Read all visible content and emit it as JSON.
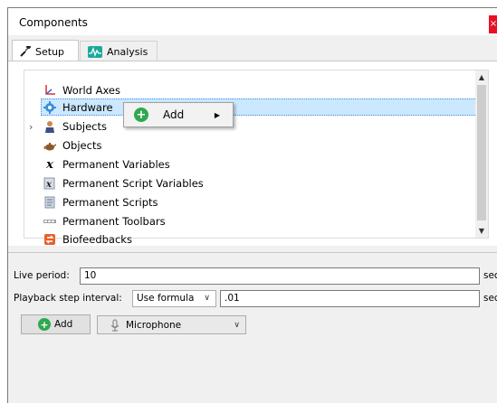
{
  "window": {
    "title": "Components",
    "close_glyph": "×"
  },
  "tabs": [
    {
      "label": "Setup",
      "icon": "wrench-icon",
      "active": true
    },
    {
      "label": "Analysis",
      "icon": "waveform-icon",
      "active": false
    }
  ],
  "tree": {
    "items": [
      {
        "label": "World Axes",
        "icon": "axes-icon"
      },
      {
        "label": "Hardware",
        "icon": "gear-icon",
        "selected": true
      },
      {
        "label": "Subjects",
        "icon": "person-icon",
        "expandable": true
      },
      {
        "label": "Objects",
        "icon": "teapot-icon"
      },
      {
        "label": "Permanent Variables",
        "icon": "variable-x-icon"
      },
      {
        "label": "Permanent Script Variables",
        "icon": "script-variable-icon"
      },
      {
        "label": "Permanent Scripts",
        "icon": "scroll-icon"
      },
      {
        "label": "Permanent Toolbars",
        "icon": "toolbar-icon"
      },
      {
        "label": "Biofeedbacks",
        "icon": "biofeedback-icon"
      }
    ]
  },
  "context_menu": {
    "items": [
      {
        "label": "Add",
        "has_submenu": true
      }
    ]
  },
  "settings": {
    "live_period": {
      "label": "Live period:",
      "value": "10",
      "unit": "sec"
    },
    "playback_step": {
      "label": "Playback step interval:",
      "mode": "Use formula",
      "value": ".01",
      "unit": "sec"
    }
  },
  "toolbar": {
    "add_label": "Add",
    "source_select": "Microphone"
  },
  "colors": {
    "selection": "#cce8ff",
    "accent_green": "#2fa84f",
    "close_red": "#e81123"
  }
}
